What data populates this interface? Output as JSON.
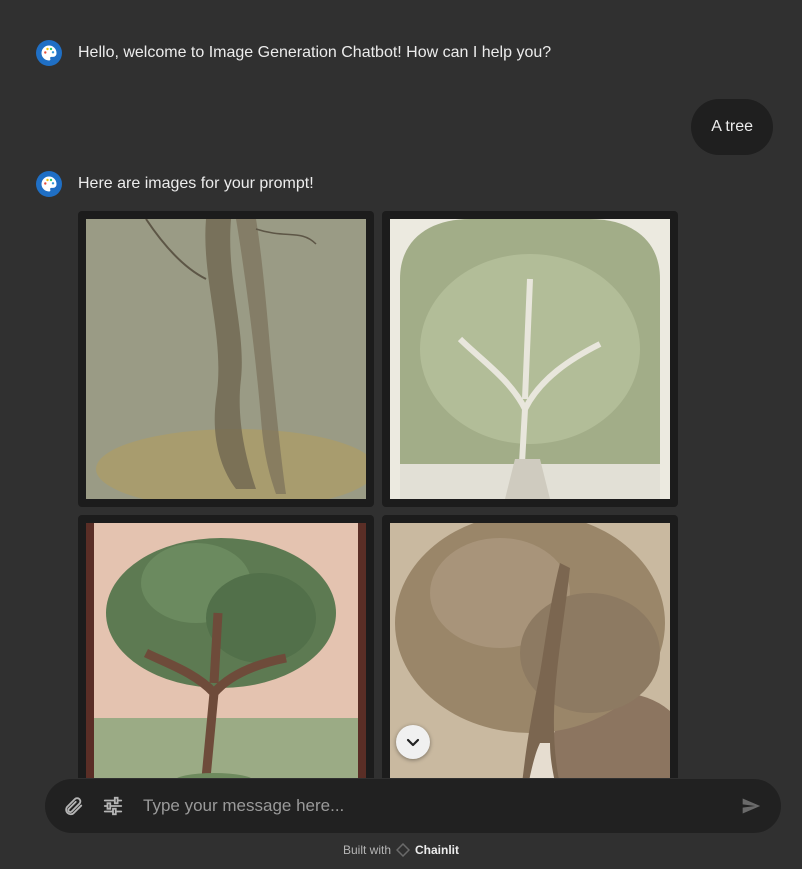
{
  "messages": [
    {
      "author": "assistant",
      "text": "Hello, welcome to Image Generation Chatbot! How can I help you?"
    },
    {
      "author": "user",
      "text": "A tree"
    },
    {
      "author": "assistant",
      "text": "Here are images for your prompt!"
    }
  ],
  "images": [
    {
      "icon": "generated-tree-image-1"
    },
    {
      "icon": "generated-tree-image-2"
    },
    {
      "icon": "generated-tree-image-3"
    },
    {
      "icon": "generated-tree-image-4"
    }
  ],
  "composer": {
    "placeholder": "Type your message here...",
    "value": ""
  },
  "footer": {
    "prefix": "Built with",
    "brand": "Chainlit"
  },
  "colors": {
    "background": "#303030",
    "composer": "#212121",
    "bubble": "#1f1f1f",
    "avatar": "#1f6fc5"
  }
}
